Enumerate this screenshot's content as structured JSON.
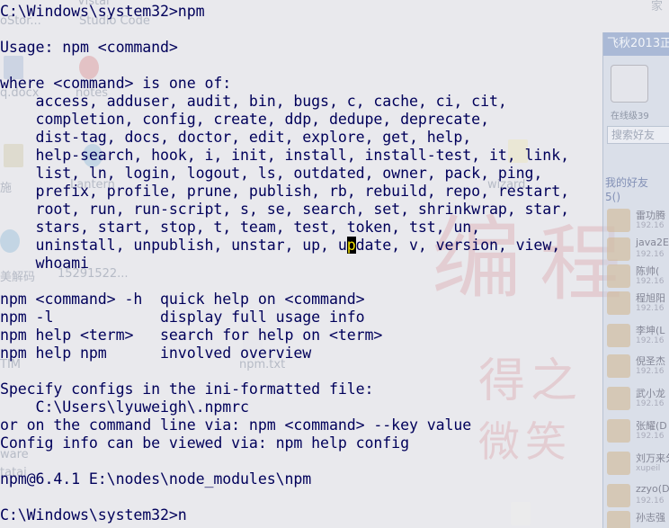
{
  "desktop": {
    "labels": [
      "Vistal",
      "oStor...",
      "Studio Code",
      "q.docx",
      "notes",
      "施",
      "Lantern",
      "wizard",
      "美解码",
      "15291522...",
      "TIM",
      "npm.txt",
      "ware",
      "tatai",
      "家"
    ],
    "background_art": [
      "编",
      "程",
      "得之",
      "微笑"
    ]
  },
  "qq_panel": {
    "title": "飞秋2013正",
    "level": "在线级39",
    "search_placeholder": "搜索好友",
    "group": "我的好友",
    "count": "5()",
    "contacts": [
      {
        "name": "雷功腾",
        "sub": "192.16"
      },
      {
        "name": "java2E53",
        "sub": "192.16"
      },
      {
        "name": "陈帅(",
        "sub": "192.16"
      },
      {
        "name": "程旭阳",
        "sub": "192.16"
      },
      {
        "name": "李坤(L",
        "sub": "192.16"
      },
      {
        "name": "倪圣杰",
        "sub": "192.16"
      },
      {
        "name": "武小龙",
        "sub": "192.16"
      },
      {
        "name": "张耀(D",
        "sub": "192.16"
      },
      {
        "name": "刘万来分",
        "sub": "xupeil"
      },
      {
        "name": "zzyo(D",
        "sub": "192.16"
      },
      {
        "name": "孙志强",
        "sub": ""
      }
    ]
  },
  "console": {
    "lines": [
      "C:\\Windows\\system32>npm",
      "",
      "Usage: npm <command>",
      "",
      "where <command> is one of:",
      "    access, adduser, audit, bin, bugs, c, cache, ci, cit,",
      "    completion, config, create, ddp, dedupe, deprecate,",
      "    dist-tag, docs, doctor, edit, explore, get, help,",
      "    help-search, hook, i, init, install, install-test, it, link,",
      "    list, ln, login, logout, ls, outdated, owner, pack, ping,",
      "    prefix, profile, prune, publish, rb, rebuild, repo, restart,",
      "    root, run, run-script, s, se, search, set, shrinkwrap, star,",
      "    stars, start, stop, t, team, test, token, tst, un,",
      "",
      "    whoami",
      "",
      "npm <command> -h  quick help on <command>",
      "npm -l            display full usage info",
      "npm help <term>   search for help on <term>",
      "npm help npm      involved overview",
      "",
      "Specify configs in the ini-formatted file:",
      "    C:\\Users\\lyuweigh\\.npmrc",
      "or on the command line via: npm <command> --key value",
      "Config info can be viewed via: npm help config",
      "",
      "npm@6.4.1 E:\\nodes\\node_modules\\npm",
      "",
      "C:\\Windows\\system32>n"
    ],
    "cursor_line": {
      "before": "    uninstall, unpublish, unstar, up, u",
      "cursor_char": "p",
      "after": "date, v, version, view,"
    }
  },
  "colors": {
    "console_text": "#00005a",
    "cursor_bg": "#000000",
    "cursor_fg": "#f0e000"
  }
}
